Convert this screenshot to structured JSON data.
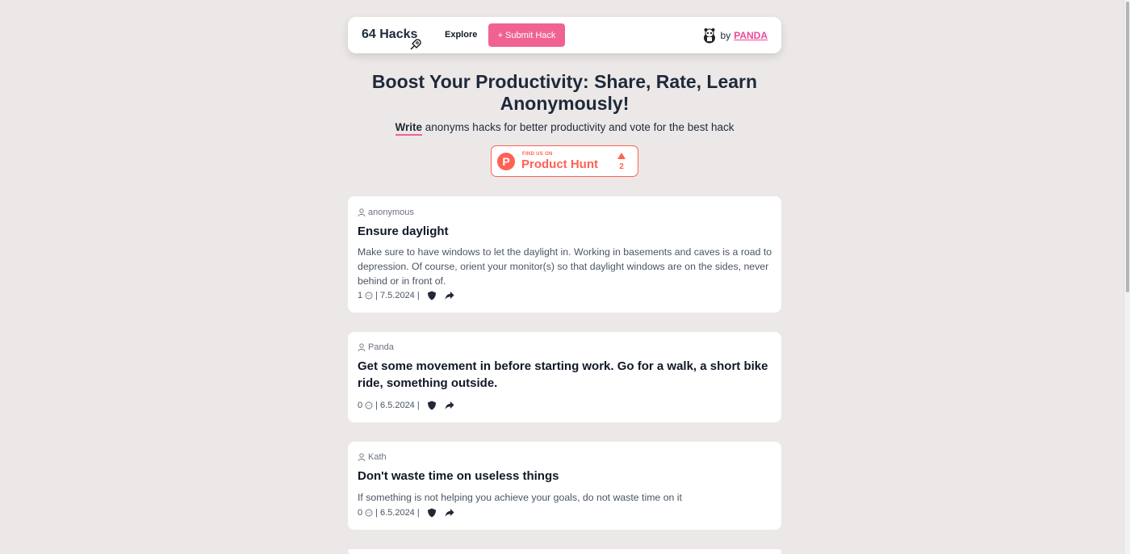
{
  "header": {
    "logo": "64 Hacks",
    "nav_explore": "Explore",
    "submit_label": "+ Submit Hack",
    "by_label": "by",
    "author_link": "PANDA"
  },
  "hero": {
    "title": "Boost Your Productivity: Share, Rate, Learn Anonymously!",
    "sub_write": "Write",
    "sub_rest": " anonyms hacks for better productivity and vote for the best hack"
  },
  "product_hunt": {
    "find_text": "FIND US ON",
    "name": "Product Hunt",
    "upvotes": "2"
  },
  "hacks": [
    {
      "author": "anonymous",
      "title": "Ensure daylight",
      "body": "Make sure to have windows to let the daylight in. Working in basements and caves is a road to depression. Of course, orient your monitor(s) so that daylight windows are on the sides, never behind or in front of.",
      "comments": "1",
      "date": "7.5.2024"
    },
    {
      "author": "Panda",
      "title": "Get some movement in before starting work. Go for a walk, a short bike ride, something outside.",
      "body": "",
      "comments": "0",
      "date": "6.5.2024"
    },
    {
      "author": "Kath",
      "title": "Don't waste time on useless things",
      "body": "If something is not helping you achieve your goals, do not waste time on it",
      "comments": "0",
      "date": "6.5.2024"
    }
  ],
  "colors": {
    "accent": "#f06292",
    "product_hunt": "#ff6154",
    "background": "#ece8e7"
  },
  "icons": [
    "rocket-icon",
    "panda-icon",
    "user-icon",
    "chat-icon",
    "shield-icon",
    "share-icon"
  ]
}
